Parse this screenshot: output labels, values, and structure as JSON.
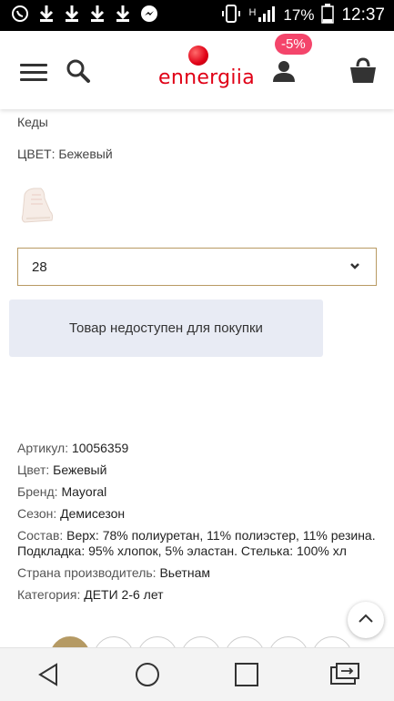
{
  "status_bar": {
    "battery": "17%",
    "time": "12:37",
    "signal_label": "H"
  },
  "header": {
    "logo_text": "ennergiia",
    "discount_badge": "-5%"
  },
  "product": {
    "name": "Кеды",
    "color_line": "ЦВЕТ: Бежевый",
    "size_selected": "28",
    "unavailable_button": "Товар недоступен для покупки"
  },
  "specs": {
    "article_label": "Артикул:",
    "article_value": "10056359",
    "color_label": "Цвет:",
    "color_value": "Бежевый",
    "brand_label": "Бренд:",
    "brand_value": "Mayoral",
    "season_label": "Сезон:",
    "season_value": "Демисезон",
    "composition_label": "Состав:",
    "composition_value": "Верх: 78% полиуретан, 11% полиэстер, 11% резина. Подкладка: 95% хлопок, 5% эластан. Стелька: 100% хл",
    "country_label": "Страна производитель:",
    "country_value": "Вьетнам",
    "category_label": "Категория:",
    "category_value": "ДЕТИ 2-6 лет"
  },
  "colors": {
    "accent": "#e00016",
    "badge": "#f4456b",
    "select_border": "#b99a63",
    "button_bg": "#e8ebf4"
  },
  "icons": [
    "viber-icon",
    "download-icon",
    "download-icon",
    "download-icon",
    "download-icon",
    "facebook-messenger-icon",
    "phone-icon",
    "signal-icon",
    "battery-icon",
    "menu-icon",
    "search-icon",
    "user-icon",
    "cart-icon",
    "chevron-down-icon",
    "chevron-up-icon",
    "back-icon",
    "home-icon",
    "recents-icon",
    "screen-share-icon"
  ]
}
